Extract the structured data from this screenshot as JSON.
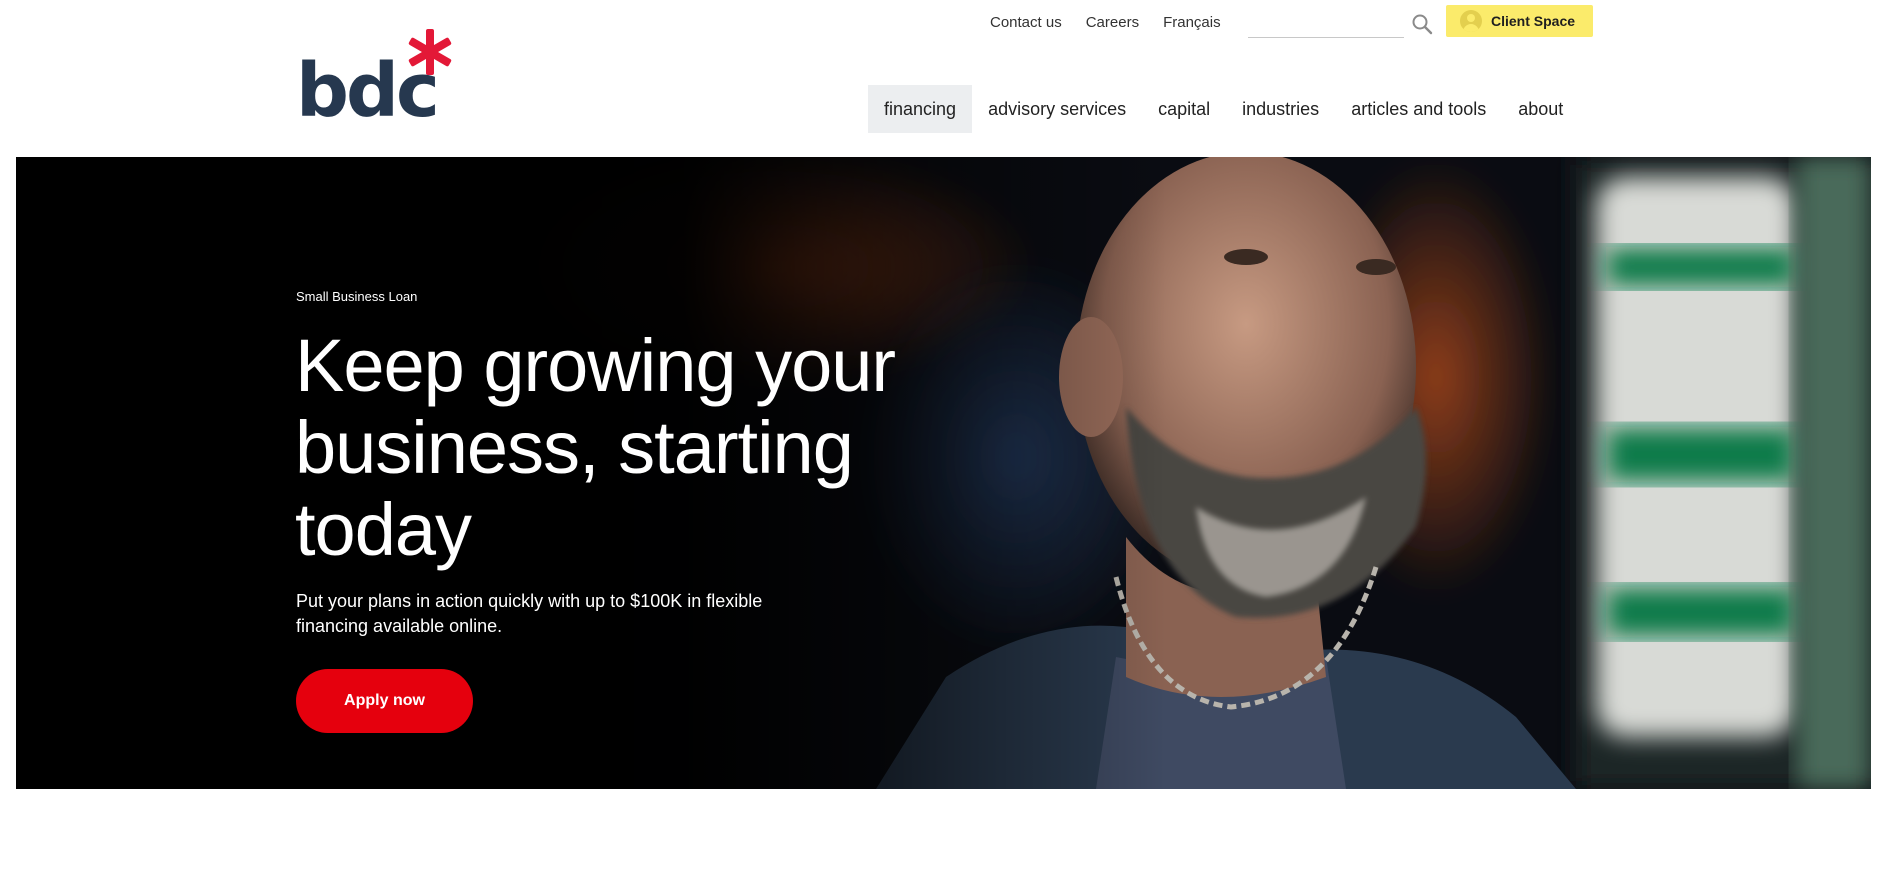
{
  "brand": {
    "name": "bdc",
    "accent_color": "#e31837",
    "logo_color": "#26384f"
  },
  "utility_nav": {
    "links": [
      "Contact us",
      "Careers",
      "Français"
    ],
    "search_placeholder": "",
    "client_space_label": "Client Space"
  },
  "main_nav": {
    "items": [
      "financing",
      "advisory services",
      "capital",
      "industries",
      "articles and tools",
      "about"
    ],
    "active": "financing"
  },
  "hero": {
    "eyebrow": "Small Business Loan",
    "headline": "Keep growing your business, starting today",
    "subtext": "Put your plans in action quickly with up to $100K in flexible financing available online.",
    "cta_label": "Apply now",
    "cta_color": "#e5000d"
  }
}
